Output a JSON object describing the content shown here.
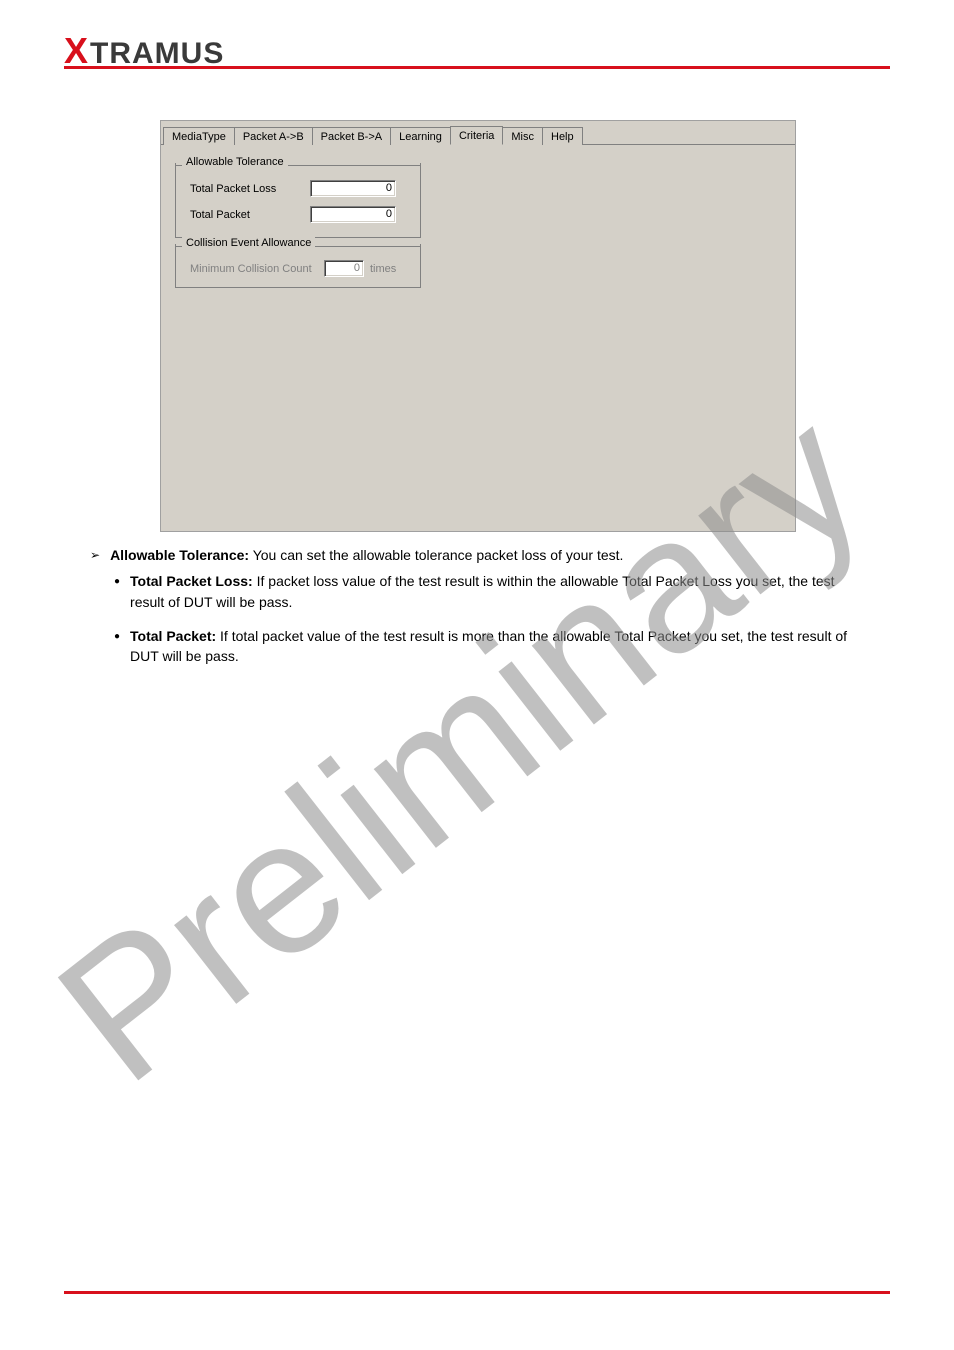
{
  "logo": {
    "prefix": "X",
    "rest": "TRAMUS"
  },
  "tabs": [
    {
      "label": "MediaType",
      "active": false
    },
    {
      "label": "Packet A->B",
      "active": false
    },
    {
      "label": "Packet B->A",
      "active": false
    },
    {
      "label": "Learning",
      "active": false
    },
    {
      "label": "Criteria",
      "active": true
    },
    {
      "label": "Misc",
      "active": false
    },
    {
      "label": "Help",
      "active": false
    }
  ],
  "groups": {
    "allowable": {
      "title": "Allowable Tolerance",
      "rows": [
        {
          "label": "Total Packet Loss",
          "value": "0"
        },
        {
          "label": "Total Packet",
          "value": "0"
        }
      ]
    },
    "collision": {
      "title": "Collision Event Allowance",
      "row": {
        "label": "Minimum Collision Count",
        "value": "0",
        "suffix": "times"
      }
    }
  },
  "body": {
    "lvl1_label": "Allowable Tolerance:",
    "lvl1_text": " You can set the allowable tolerance packet loss of your test.",
    "item1_label": "Total Packet Loss:",
    "item1_text": " If packet loss value of the test result is within the allowable Total Packet Loss you set, the test result of DUT will be pass.",
    "item2_label": "Total Packet:",
    "item2_text": " If total packet value of the test result is more than the allowable Total Packet you set, the test result of DUT will be pass."
  },
  "watermark_text": "Preliminary"
}
